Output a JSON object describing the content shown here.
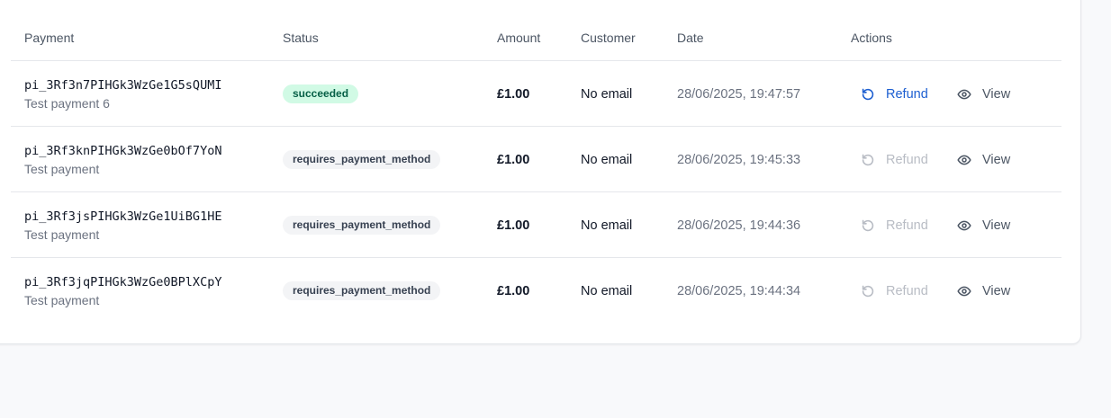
{
  "columns": {
    "payment": "Payment",
    "status": "Status",
    "amount": "Amount",
    "customer": "Customer",
    "date": "Date",
    "actions": "Actions"
  },
  "rows": [
    {
      "id": "pi_3Rf3n7PIHGk3WzGe1G5sQUMI",
      "description": "Test payment 6",
      "status": "succeeded",
      "amount": "£1.00",
      "customer": "No email",
      "date": "28/06/2025, 19:47:57",
      "refund_label": "Refund",
      "refund_enabled": true,
      "view_label": "View"
    },
    {
      "id": "pi_3Rf3knPIHGk3WzGe0bOf7YoN",
      "description": "Test payment",
      "status": "requires_payment_method",
      "amount": "£1.00",
      "customer": "No email",
      "date": "28/06/2025, 19:45:33",
      "refund_label": "Refund",
      "refund_enabled": false,
      "view_label": "View"
    },
    {
      "id": "pi_3Rf3jsPIHGk3WzGe1UiBG1HE",
      "description": "Test payment",
      "status": "requires_payment_method",
      "amount": "£1.00",
      "customer": "No email",
      "date": "28/06/2025, 19:44:36",
      "refund_label": "Refund",
      "refund_enabled": false,
      "view_label": "View"
    },
    {
      "id": "pi_3Rf3jqPIHGk3WzGe0BPlXCpY",
      "description": "Test payment",
      "status": "requires_payment_method",
      "amount": "£1.00",
      "customer": "No email",
      "date": "28/06/2025, 19:44:34",
      "refund_label": "Refund",
      "refund_enabled": false,
      "view_label": "View"
    }
  ],
  "icons": {
    "refund": "rotate-ccw-icon",
    "view": "eye-icon"
  },
  "colors": {
    "accent": "#1d5fd1",
    "success_bg": "#d1fae5",
    "success_text": "#065f46",
    "neutral_badge_bg": "#f3f4f6",
    "disabled_text": "#b8bcc4"
  }
}
